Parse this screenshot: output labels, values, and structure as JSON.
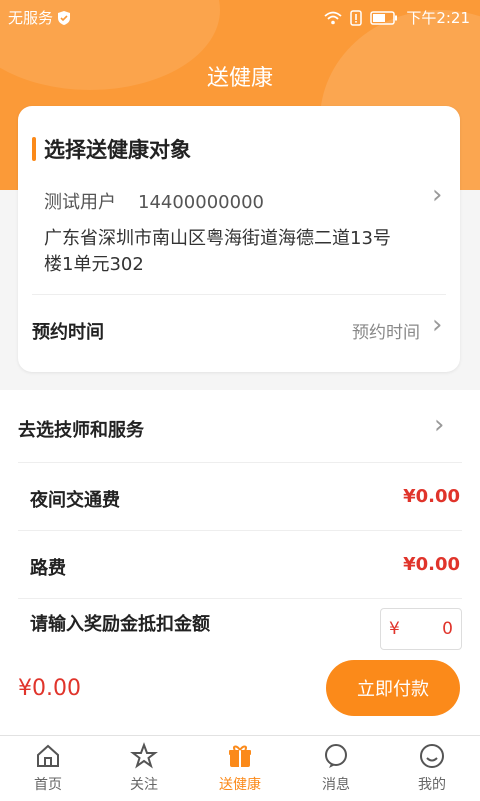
{
  "status_bar": {
    "carrier": "无服务",
    "time": "下午2:21"
  },
  "header": {
    "title": "送健康"
  },
  "recipient_card": {
    "title": "选择送健康对象",
    "user_name": "测试用户",
    "phone": "14400000000",
    "address": "广东省深圳市南山区粤海街道海德二道13号楼1单元302",
    "appointment_label": "预约时间",
    "appointment_value": "预约时间"
  },
  "service": {
    "select_label": "去选技师和服务",
    "night_fee_label": "夜间交通费",
    "night_fee_value": "¥0.00",
    "travel_fee_label": "路费",
    "travel_fee_value": "¥0.00",
    "bonus_label": "请输入奖励金抵扣金额",
    "bonus_currency": "¥",
    "bonus_value": "0"
  },
  "footer": {
    "total": "¥0.00",
    "pay_button": "立即付款"
  },
  "tabbar": {
    "items": [
      {
        "label": "首页",
        "icon": "home-icon"
      },
      {
        "label": "关注",
        "icon": "star-icon"
      },
      {
        "label": "送健康",
        "icon": "gift-icon"
      },
      {
        "label": "消息",
        "icon": "message-icon"
      },
      {
        "label": "我的",
        "icon": "profile-icon"
      }
    ],
    "active": 2
  },
  "colors": {
    "accent": "#fb8a1a",
    "price": "#e0342b",
    "header_bg": "#fb9a38"
  }
}
